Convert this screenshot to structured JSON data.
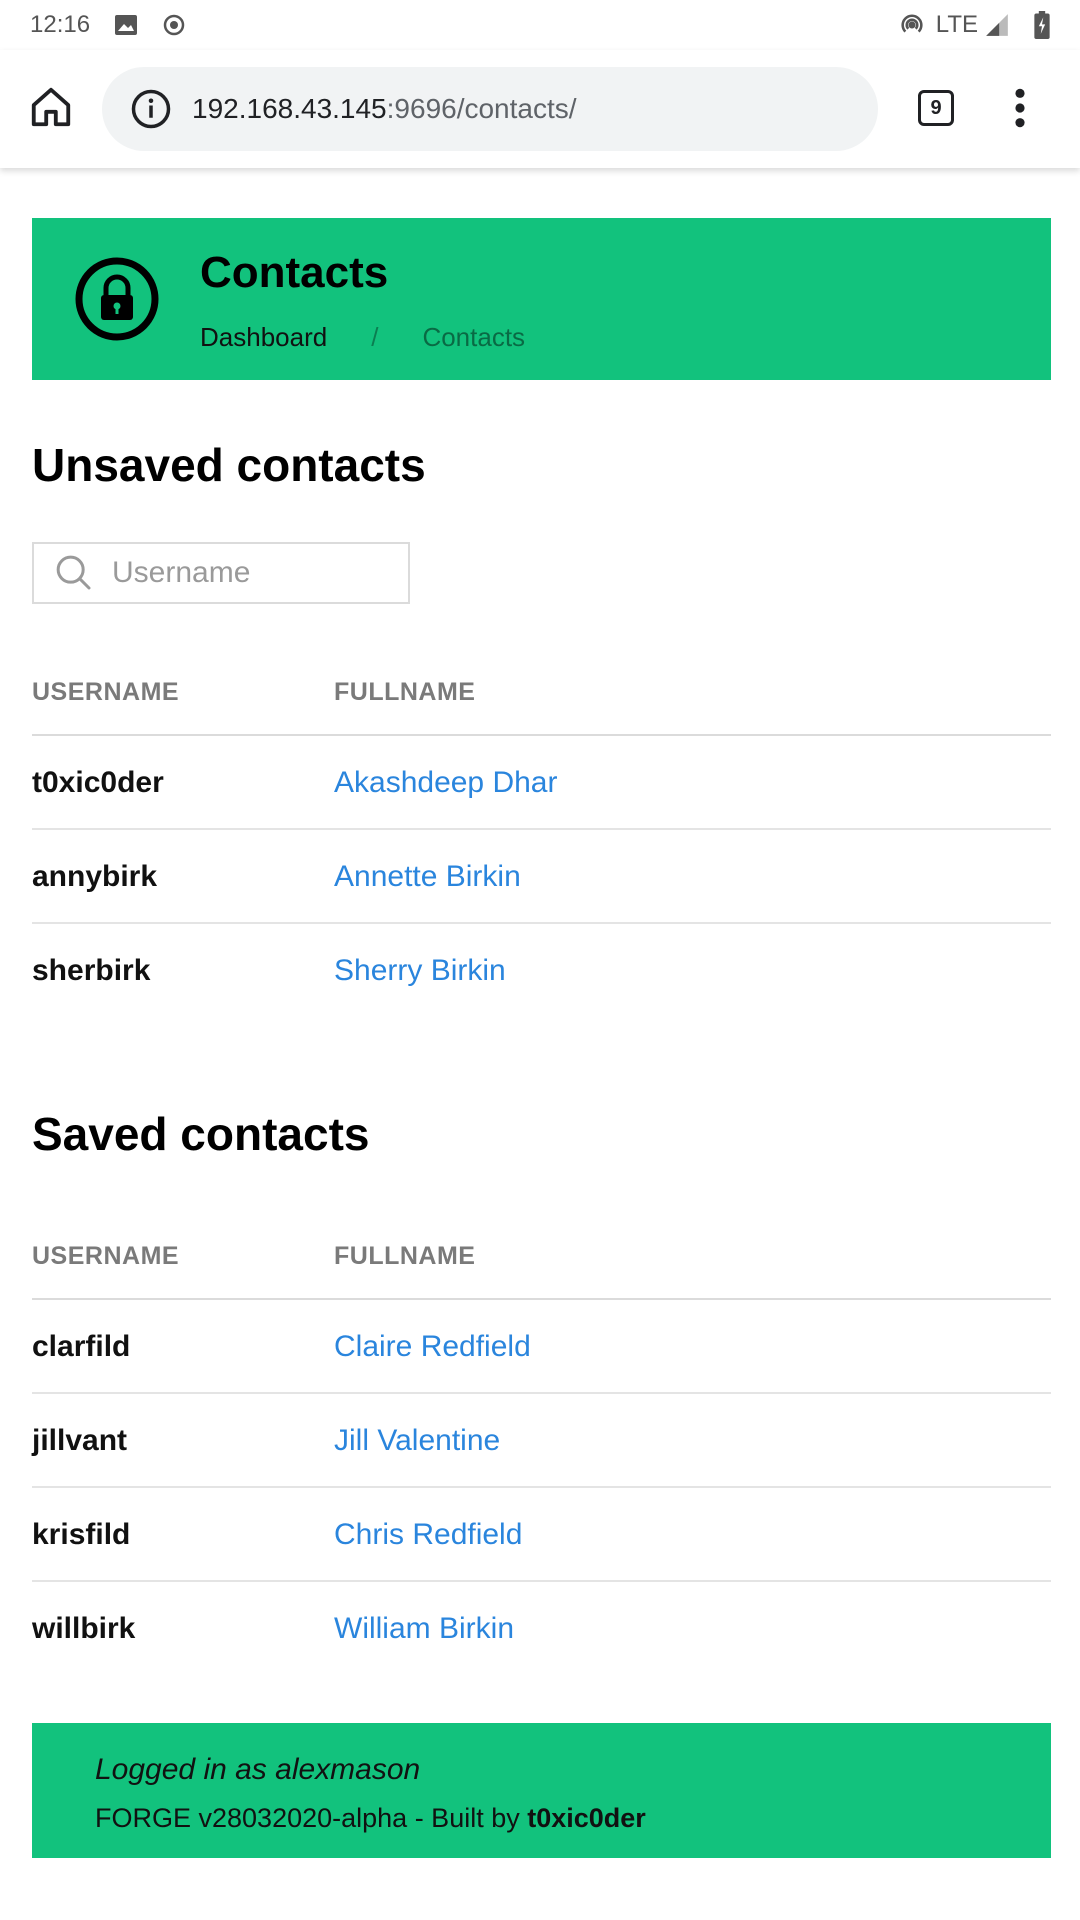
{
  "status_bar": {
    "time": "12:16",
    "network": "LTE"
  },
  "browser": {
    "url_host": "192.168.43.145",
    "url_rest": ":9696/contacts/",
    "tab_count": "9"
  },
  "header": {
    "title": "Contacts",
    "breadcrumb": {
      "dashboard": "Dashboard",
      "separator": "/",
      "current": "Contacts"
    }
  },
  "unsaved": {
    "title": "Unsaved contacts",
    "search_placeholder": "Username",
    "columns": {
      "username": "USERNAME",
      "fullname": "FULLNAME"
    },
    "rows": [
      {
        "username": "t0xic0der",
        "fullname": "Akashdeep Dhar"
      },
      {
        "username": "annybirk",
        "fullname": "Annette Birkin"
      },
      {
        "username": "sherbirk",
        "fullname": "Sherry Birkin"
      }
    ]
  },
  "saved": {
    "title": "Saved contacts",
    "columns": {
      "username": "USERNAME",
      "fullname": "FULLNAME"
    },
    "rows": [
      {
        "username": "clarfild",
        "fullname": "Claire Redfield"
      },
      {
        "username": "jillvant",
        "fullname": "Jill Valentine"
      },
      {
        "username": "krisfild",
        "fullname": "Chris Redfield"
      },
      {
        "username": "willbirk",
        "fullname": "William Birkin"
      }
    ]
  },
  "footer": {
    "login_text": "Logged in as alexmason",
    "build_prefix": "FORGE v28032020-alpha - Built by ",
    "build_author": "t0xic0der"
  },
  "colors": {
    "accent": "#12c27d",
    "link": "#2a85dd"
  },
  "icons": {
    "home": "home-icon",
    "info": "info-icon",
    "menu": "more-vert-icon",
    "lock": "lock-icon",
    "search": "search-icon"
  }
}
